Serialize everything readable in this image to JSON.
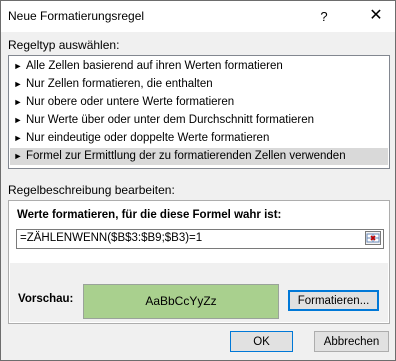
{
  "dialog": {
    "title": "Neue Formatierungsregel",
    "help_label": "?",
    "close_label": "✕"
  },
  "rule_type": {
    "label": "Regeltyp auswählen:",
    "items": [
      {
        "label": "Alle Zellen basierend auf ihren Werten formatieren"
      },
      {
        "label": "Nur Zellen formatieren, die enthalten"
      },
      {
        "label": "Nur obere oder untere Werte formatieren"
      },
      {
        "label": "Nur Werte über oder unter dem Durchschnitt formatieren"
      },
      {
        "label": "Nur eindeutige oder doppelte Werte formatieren"
      },
      {
        "label": "Formel zur Ermittlung der zu formatierenden Zellen verwenden"
      }
    ],
    "item_arrow": "►",
    "selected_index": 5
  },
  "rule_description": {
    "label": "Regelbeschreibung bearbeiten:",
    "formula_label": "Werte formatieren, für die diese Formel wahr ist:",
    "formula_value": "=ZÄHLENWENN($B$3:$B9;$B3)=1",
    "preview_label": "Vorschau:",
    "preview_text": "AaBbCcYyZz",
    "preview_color": "#a9d08e",
    "format_button": "Formatieren..."
  },
  "footer": {
    "ok_label": "OK",
    "cancel_label": "Abbrechen"
  }
}
